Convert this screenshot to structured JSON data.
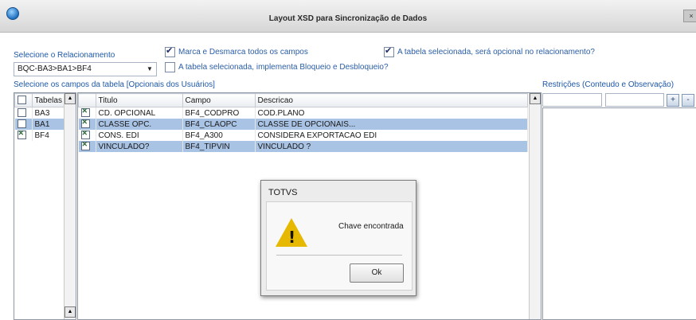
{
  "window": {
    "title": "Layout XSD para Sincronização de Dados",
    "close_label": "×"
  },
  "relationship": {
    "label": "Selecione o Relacionamento",
    "selected": "BQC-BA3>BA1>BF4"
  },
  "options": {
    "mark_all": {
      "label": "Marca e Desmarca todos os campos",
      "checked": true
    },
    "implement_lock": {
      "label": "A tabela selecionada, implementa Bloqueio e Desbloqueio?",
      "checked": false
    },
    "optional": {
      "label": "A tabela selecionada, será opcional no relacionamento?",
      "checked": true
    }
  },
  "fields_label": "Selecione os campos da tabela [Opcionais dos Usuários]",
  "restrictions_label": "Restrições (Conteudo e Observação)",
  "tables": {
    "header": "Tabelas",
    "rows": [
      {
        "name": "BA3",
        "checked": false
      },
      {
        "name": "BA1",
        "checked": false
      },
      {
        "name": "BF4",
        "checked": true
      }
    ]
  },
  "fields": {
    "columns": [
      "Titulo",
      "Campo",
      "Descricao"
    ],
    "rows": [
      {
        "titulo": "CD. OPCIONAL",
        "campo": "BF4_CODPRO",
        "descricao": "COD.PLANO"
      },
      {
        "titulo": "CLASSE OPC.",
        "campo": "BF4_CLAOPC",
        "descricao": "CLASSE DE OPCIONAIS..."
      },
      {
        "titulo": "CONS. EDI",
        "campo": "BF4_A300",
        "descricao": "CONSIDERA EXPORTACAO EDI"
      },
      {
        "titulo": "VINCULADO?",
        "campo": "BF4_TIPVIN",
        "descricao": "VINCULADO ?"
      }
    ]
  },
  "restrictions": {
    "add_label": "+",
    "remove_label": "-"
  },
  "dialog": {
    "title": "TOTVS",
    "message": "Chave encontrada",
    "ok_label": "Ok"
  },
  "icons": {
    "warning": "warning-icon",
    "app": "app-icon"
  }
}
